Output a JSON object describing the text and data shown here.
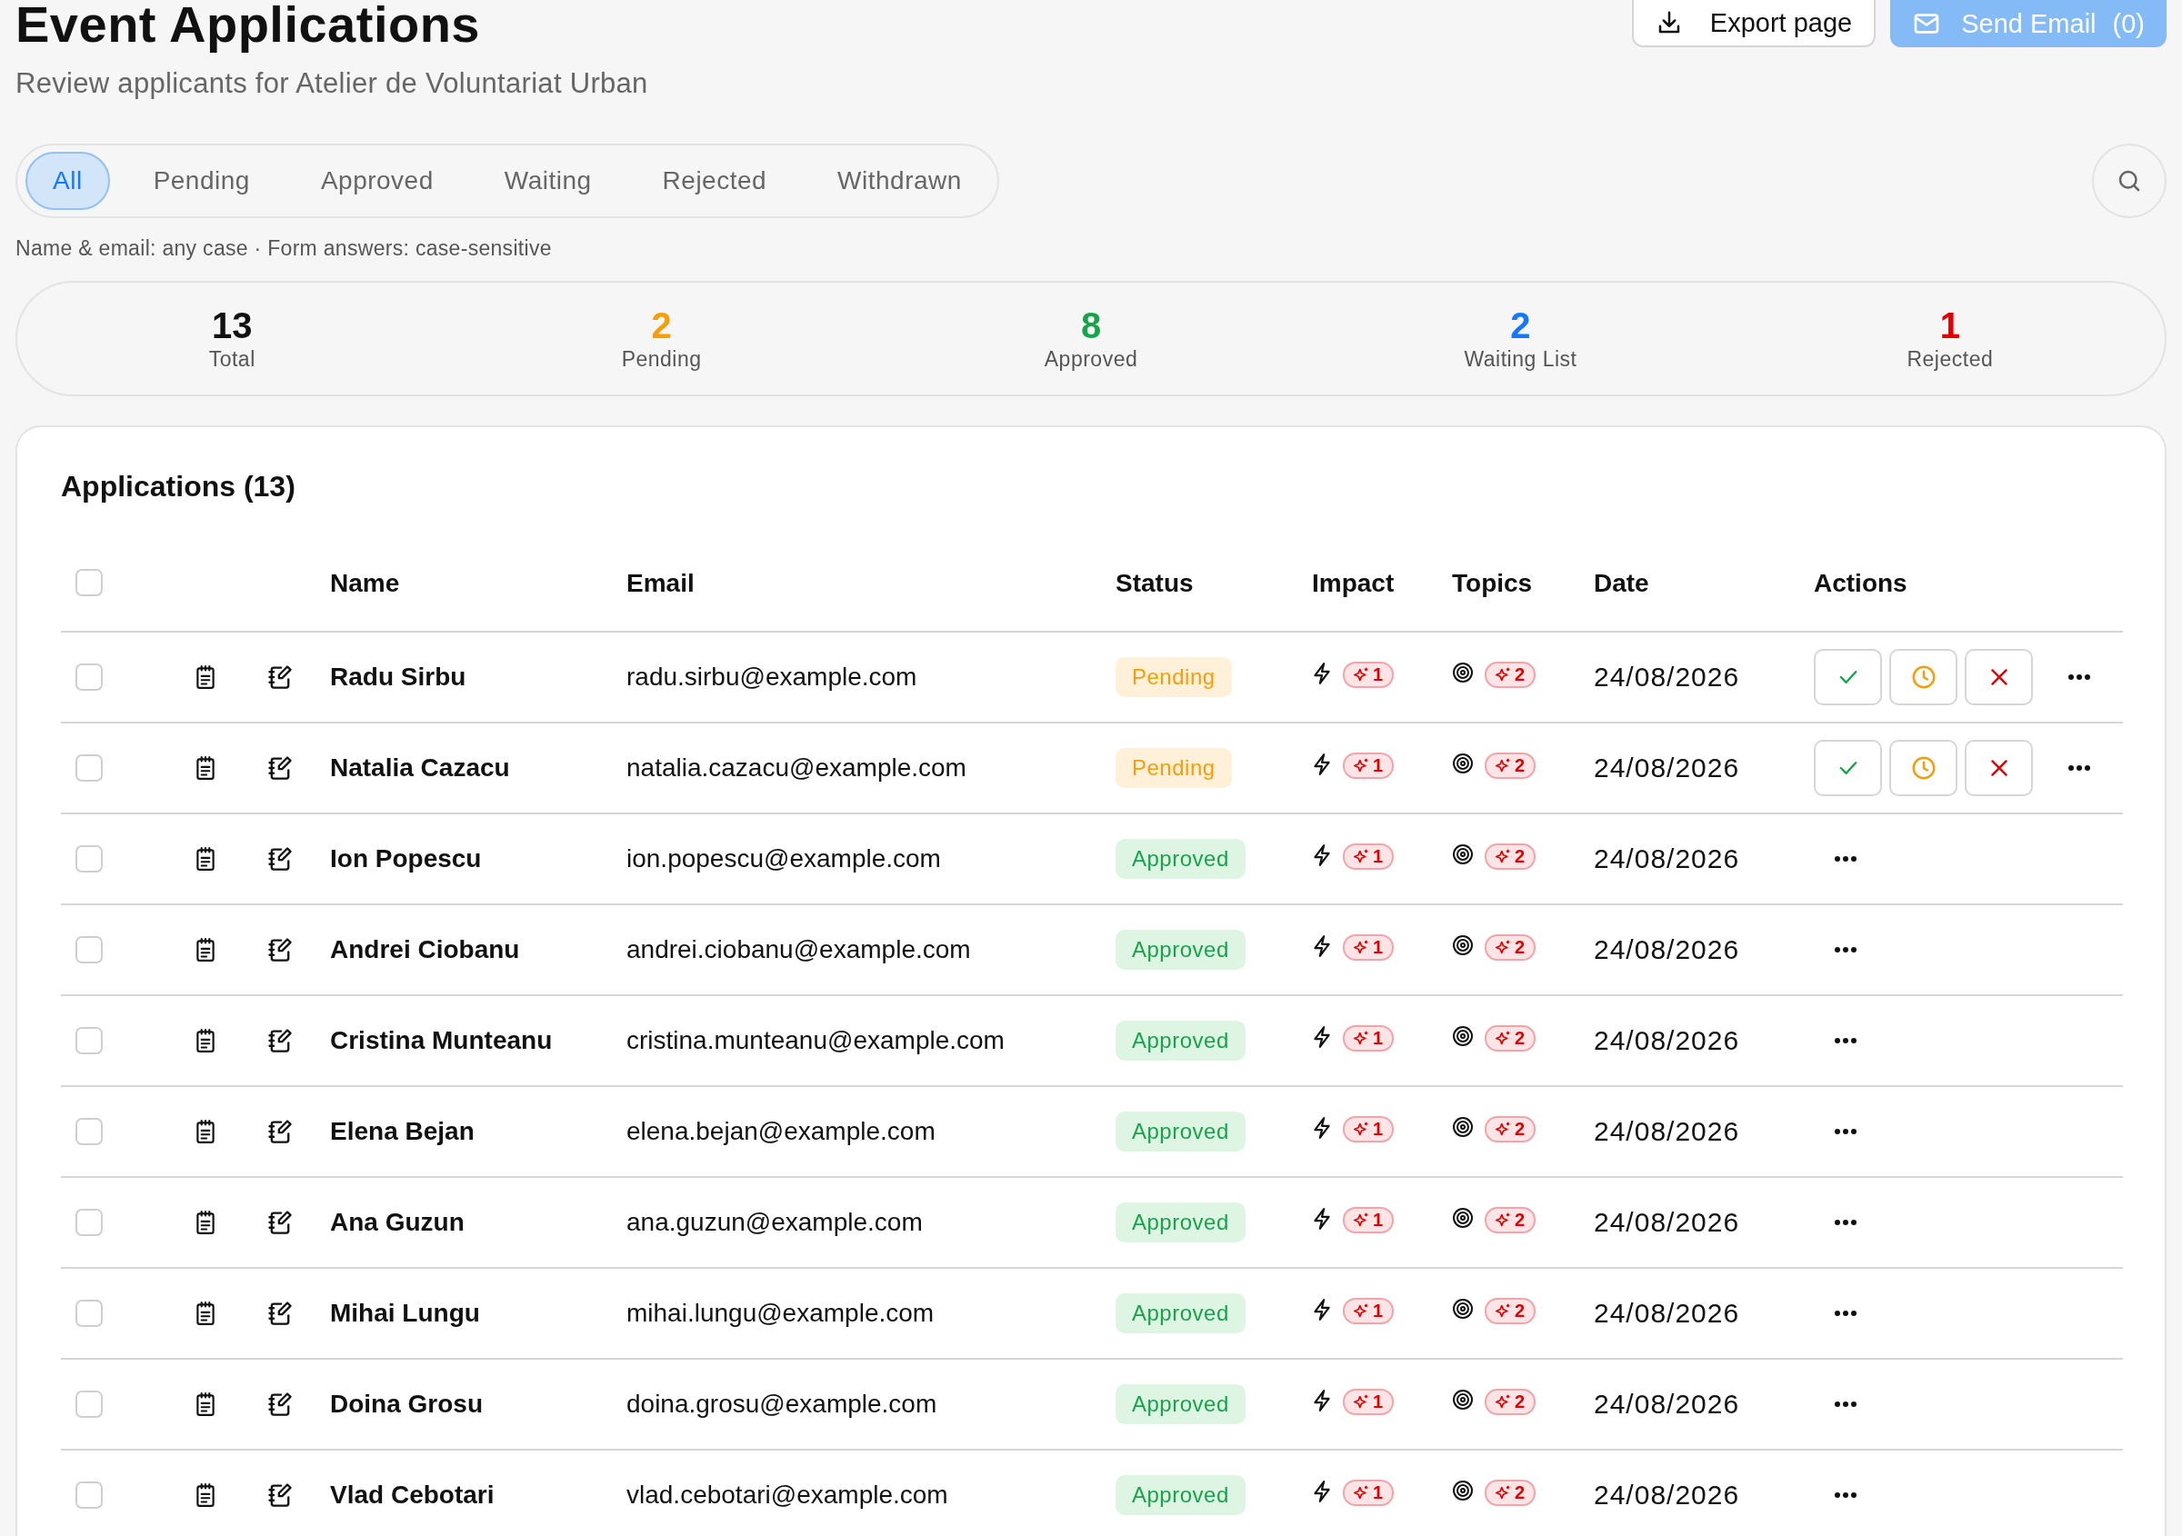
{
  "header": {
    "title": "Event Applications",
    "subtitle": "Review applicants for Atelier de Voluntariat Urban",
    "export_button": "Export page",
    "send_email_button": {
      "label": "Send Email",
      "count": "(0)",
      "disabled": true
    }
  },
  "filter_tabs": [
    {
      "label": "All",
      "selected": true
    },
    {
      "label": "Pending",
      "selected": false
    },
    {
      "label": "Approved",
      "selected": false
    },
    {
      "label": "Waiting",
      "selected": false
    },
    {
      "label": "Rejected",
      "selected": false
    },
    {
      "label": "Withdrawn",
      "selected": false
    }
  ],
  "search_hint": "Name & email: any case · Form answers: case-sensitive",
  "stats": [
    {
      "value": "13",
      "label": "Total",
      "color": "#111111"
    },
    {
      "value": "2",
      "label": "Pending",
      "color": "#f59e0b"
    },
    {
      "value": "8",
      "label": "Approved",
      "color": "#16a34a"
    },
    {
      "value": "2",
      "label": "Waiting List",
      "color": "#1677ff"
    },
    {
      "value": "1",
      "label": "Rejected",
      "color": "#e00000"
    }
  ],
  "table": {
    "title": "Applications (13)",
    "select_all_checked": false,
    "columns": [
      "Name",
      "Email",
      "Status",
      "Impact",
      "Topics",
      "Date",
      "Actions"
    ],
    "rows": [
      {
        "checked": false,
        "name": "Radu Sirbu",
        "email": "radu.sirbu@example.com",
        "status": "Pending",
        "kind": "pending",
        "impact_count": "1",
        "topics_count": "2",
        "date": "24/08/2026"
      },
      {
        "checked": false,
        "name": "Natalia Cazacu",
        "email": "natalia.cazacu@example.com",
        "status": "Pending",
        "kind": "pending",
        "impact_count": "1",
        "topics_count": "2",
        "date": "24/08/2026"
      },
      {
        "checked": false,
        "name": "Ion Popescu",
        "email": "ion.popescu@example.com",
        "status": "Approved",
        "kind": "approved",
        "impact_count": "1",
        "topics_count": "2",
        "date": "24/08/2026"
      },
      {
        "checked": false,
        "name": "Andrei Ciobanu",
        "email": "andrei.ciobanu@example.com",
        "status": "Approved",
        "kind": "approved",
        "impact_count": "1",
        "topics_count": "2",
        "date": "24/08/2026"
      },
      {
        "checked": false,
        "name": "Cristina Munteanu",
        "email": "cristina.munteanu@example.com",
        "status": "Approved",
        "kind": "approved",
        "impact_count": "1",
        "topics_count": "2",
        "date": "24/08/2026"
      },
      {
        "checked": false,
        "name": "Elena Bejan",
        "email": "elena.bejan@example.com",
        "status": "Approved",
        "kind": "approved",
        "impact_count": "1",
        "topics_count": "2",
        "date": "24/08/2026"
      },
      {
        "checked": false,
        "name": "Ana Guzun",
        "email": "ana.guzun@example.com",
        "status": "Approved",
        "kind": "approved",
        "impact_count": "1",
        "topics_count": "2",
        "date": "24/08/2026"
      },
      {
        "checked": false,
        "name": "Mihai Lungu",
        "email": "mihai.lungu@example.com",
        "status": "Approved",
        "kind": "approved",
        "impact_count": "1",
        "topics_count": "2",
        "date": "24/08/2026"
      },
      {
        "checked": false,
        "name": "Doina Grosu",
        "email": "doina.grosu@example.com",
        "status": "Approved",
        "kind": "approved",
        "impact_count": "1",
        "topics_count": "2",
        "date": "24/08/2026"
      },
      {
        "checked": false,
        "name": "Vlad Cebotari",
        "email": "vlad.cebotari@example.com",
        "status": "Approved",
        "kind": "approved",
        "impact_count": "1",
        "topics_count": "2",
        "date": "24/08/2026"
      }
    ]
  }
}
